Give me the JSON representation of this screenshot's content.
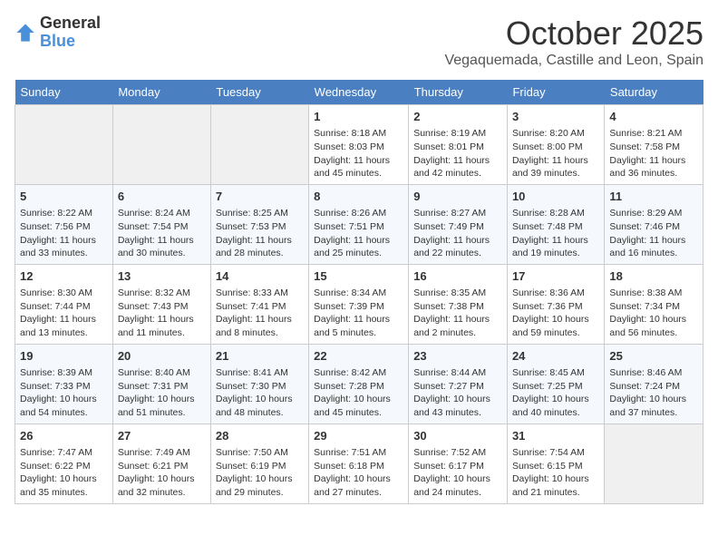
{
  "header": {
    "logo_general": "General",
    "logo_blue": "Blue",
    "month": "October 2025",
    "location": "Vegaquemada, Castille and Leon, Spain"
  },
  "days_of_week": [
    "Sunday",
    "Monday",
    "Tuesday",
    "Wednesday",
    "Thursday",
    "Friday",
    "Saturday"
  ],
  "weeks": [
    [
      {
        "day": "",
        "content": ""
      },
      {
        "day": "",
        "content": ""
      },
      {
        "day": "",
        "content": ""
      },
      {
        "day": "1",
        "content": "Sunrise: 8:18 AM\nSunset: 8:03 PM\nDaylight: 11 hours and 45 minutes."
      },
      {
        "day": "2",
        "content": "Sunrise: 8:19 AM\nSunset: 8:01 PM\nDaylight: 11 hours and 42 minutes."
      },
      {
        "day": "3",
        "content": "Sunrise: 8:20 AM\nSunset: 8:00 PM\nDaylight: 11 hours and 39 minutes."
      },
      {
        "day": "4",
        "content": "Sunrise: 8:21 AM\nSunset: 7:58 PM\nDaylight: 11 hours and 36 minutes."
      }
    ],
    [
      {
        "day": "5",
        "content": "Sunrise: 8:22 AM\nSunset: 7:56 PM\nDaylight: 11 hours and 33 minutes."
      },
      {
        "day": "6",
        "content": "Sunrise: 8:24 AM\nSunset: 7:54 PM\nDaylight: 11 hours and 30 minutes."
      },
      {
        "day": "7",
        "content": "Sunrise: 8:25 AM\nSunset: 7:53 PM\nDaylight: 11 hours and 28 minutes."
      },
      {
        "day": "8",
        "content": "Sunrise: 8:26 AM\nSunset: 7:51 PM\nDaylight: 11 hours and 25 minutes."
      },
      {
        "day": "9",
        "content": "Sunrise: 8:27 AM\nSunset: 7:49 PM\nDaylight: 11 hours and 22 minutes."
      },
      {
        "day": "10",
        "content": "Sunrise: 8:28 AM\nSunset: 7:48 PM\nDaylight: 11 hours and 19 minutes."
      },
      {
        "day": "11",
        "content": "Sunrise: 8:29 AM\nSunset: 7:46 PM\nDaylight: 11 hours and 16 minutes."
      }
    ],
    [
      {
        "day": "12",
        "content": "Sunrise: 8:30 AM\nSunset: 7:44 PM\nDaylight: 11 hours and 13 minutes."
      },
      {
        "day": "13",
        "content": "Sunrise: 8:32 AM\nSunset: 7:43 PM\nDaylight: 11 hours and 11 minutes."
      },
      {
        "day": "14",
        "content": "Sunrise: 8:33 AM\nSunset: 7:41 PM\nDaylight: 11 hours and 8 minutes."
      },
      {
        "day": "15",
        "content": "Sunrise: 8:34 AM\nSunset: 7:39 PM\nDaylight: 11 hours and 5 minutes."
      },
      {
        "day": "16",
        "content": "Sunrise: 8:35 AM\nSunset: 7:38 PM\nDaylight: 11 hours and 2 minutes."
      },
      {
        "day": "17",
        "content": "Sunrise: 8:36 AM\nSunset: 7:36 PM\nDaylight: 10 hours and 59 minutes."
      },
      {
        "day": "18",
        "content": "Sunrise: 8:38 AM\nSunset: 7:34 PM\nDaylight: 10 hours and 56 minutes."
      }
    ],
    [
      {
        "day": "19",
        "content": "Sunrise: 8:39 AM\nSunset: 7:33 PM\nDaylight: 10 hours and 54 minutes."
      },
      {
        "day": "20",
        "content": "Sunrise: 8:40 AM\nSunset: 7:31 PM\nDaylight: 10 hours and 51 minutes."
      },
      {
        "day": "21",
        "content": "Sunrise: 8:41 AM\nSunset: 7:30 PM\nDaylight: 10 hours and 48 minutes."
      },
      {
        "day": "22",
        "content": "Sunrise: 8:42 AM\nSunset: 7:28 PM\nDaylight: 10 hours and 45 minutes."
      },
      {
        "day": "23",
        "content": "Sunrise: 8:44 AM\nSunset: 7:27 PM\nDaylight: 10 hours and 43 minutes."
      },
      {
        "day": "24",
        "content": "Sunrise: 8:45 AM\nSunset: 7:25 PM\nDaylight: 10 hours and 40 minutes."
      },
      {
        "day": "25",
        "content": "Sunrise: 8:46 AM\nSunset: 7:24 PM\nDaylight: 10 hours and 37 minutes."
      }
    ],
    [
      {
        "day": "26",
        "content": "Sunrise: 7:47 AM\nSunset: 6:22 PM\nDaylight: 10 hours and 35 minutes."
      },
      {
        "day": "27",
        "content": "Sunrise: 7:49 AM\nSunset: 6:21 PM\nDaylight: 10 hours and 32 minutes."
      },
      {
        "day": "28",
        "content": "Sunrise: 7:50 AM\nSunset: 6:19 PM\nDaylight: 10 hours and 29 minutes."
      },
      {
        "day": "29",
        "content": "Sunrise: 7:51 AM\nSunset: 6:18 PM\nDaylight: 10 hours and 27 minutes."
      },
      {
        "day": "30",
        "content": "Sunrise: 7:52 AM\nSunset: 6:17 PM\nDaylight: 10 hours and 24 minutes."
      },
      {
        "day": "31",
        "content": "Sunrise: 7:54 AM\nSunset: 6:15 PM\nDaylight: 10 hours and 21 minutes."
      },
      {
        "day": "",
        "content": ""
      }
    ]
  ]
}
